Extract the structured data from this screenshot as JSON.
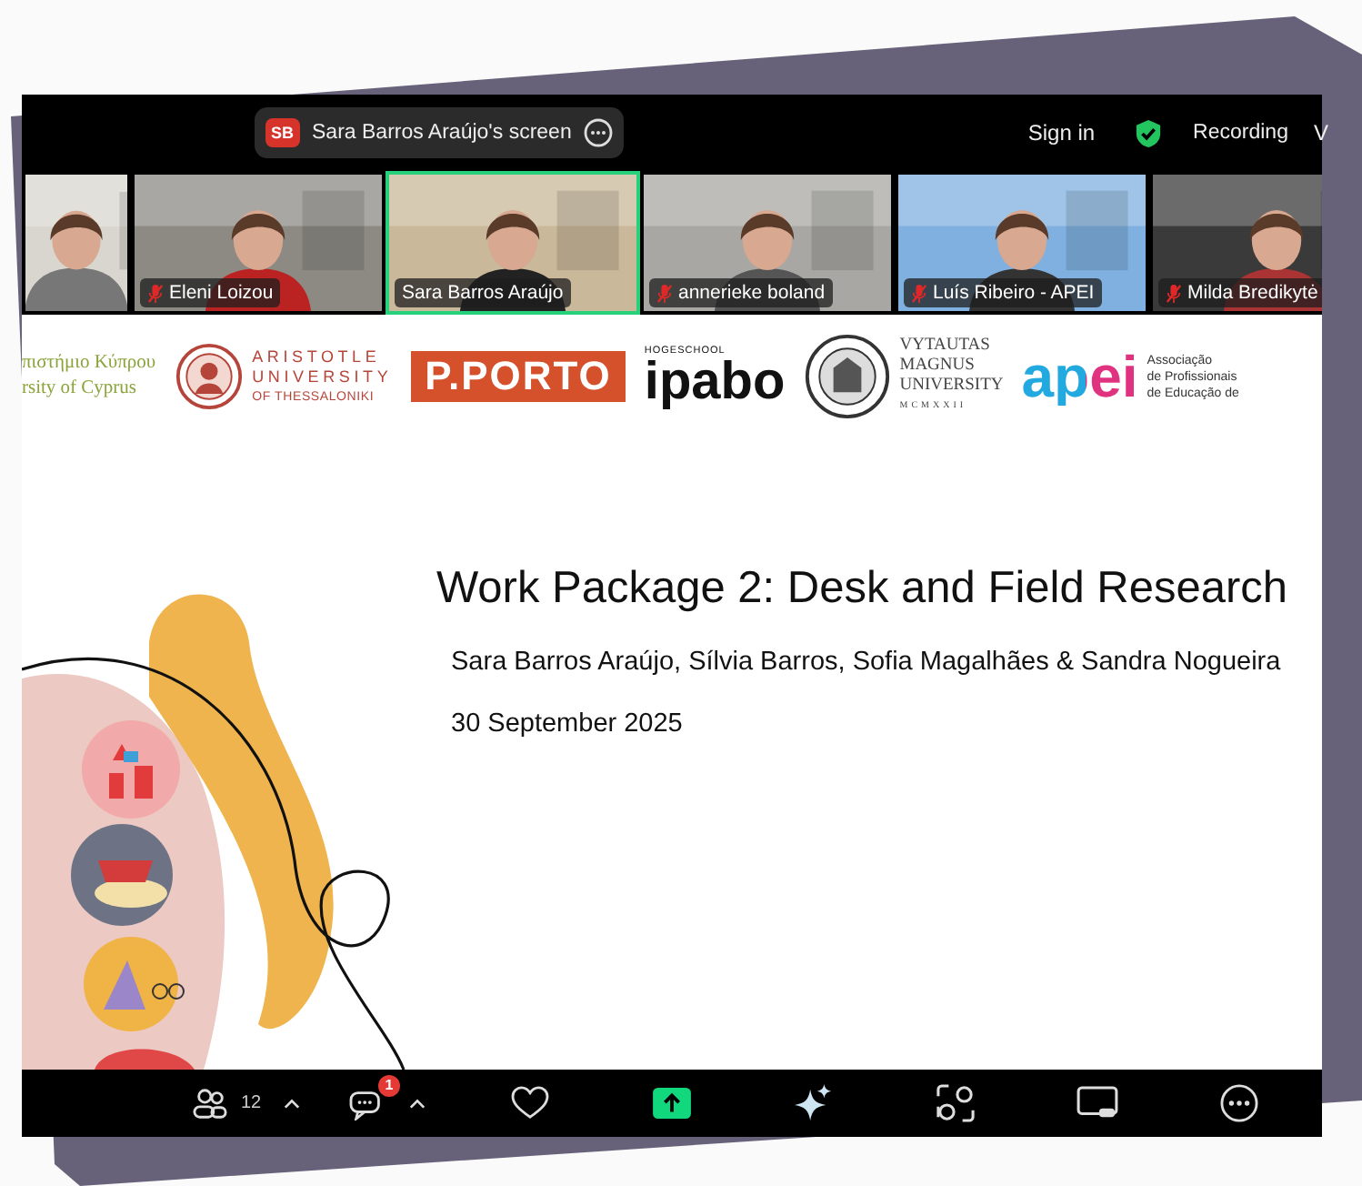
{
  "meeting_bar": {
    "share_initials": "SB",
    "share_label": "Sara Barros Araújo's screen",
    "sign_in": "Sign in",
    "recording": "Recording",
    "view_cut": "V"
  },
  "video_tiles": [
    {
      "selected": false
    },
    {
      "name": "Eleni Loizou",
      "selected": false,
      "muted": true
    },
    {
      "name": "Sara Barros Araújo",
      "selected": true,
      "muted": false
    },
    {
      "name": "annerieke boland",
      "selected": false,
      "muted": true
    },
    {
      "name": "Luís Ribeiro - APEI",
      "selected": false,
      "muted": true
    },
    {
      "name": "Milda Bredikytė",
      "selected": false,
      "muted": true
    }
  ],
  "slide": {
    "logos": [
      {
        "kind": "serif-green",
        "lines": [
          "πιστήμιο Κύπρου",
          "rsity of Cyprus"
        ]
      },
      {
        "kind": "seal-spaced",
        "lines": [
          "ARISTOTLE",
          "UNIVERSITY",
          "OF THESSALONIKI"
        ]
      },
      {
        "kind": "boxed",
        "lines": [
          "P.PORTO"
        ]
      },
      {
        "kind": "small-over-big",
        "lines": [
          "HOGESCHOOL",
          "ipabo"
        ]
      },
      {
        "kind": "seal-serif",
        "lines": [
          "VYTAUTAS",
          "MAGNUS",
          "UNIVERSITY",
          "MCMXXII"
        ]
      },
      {
        "kind": "big-beside-small",
        "lines": [
          "apei",
          "Associação",
          "de Profissionais",
          "de Educação de"
        ]
      }
    ],
    "title": "Work Package 2: Desk and Field Research",
    "authors": "Sara Barros Araújo, Sílvia Barros, Sofia Magalhães & Sandra Nogueira",
    "date": "30 September 2025"
  },
  "toolbar": [
    {
      "kind": "participants",
      "count": "12"
    },
    {
      "kind": "chat",
      "badge": "1"
    },
    {
      "kind": "react"
    },
    {
      "kind": "share"
    },
    {
      "kind": "ai"
    },
    {
      "kind": "apps"
    },
    {
      "kind": "whiteboard"
    },
    {
      "kind": "more"
    }
  ]
}
